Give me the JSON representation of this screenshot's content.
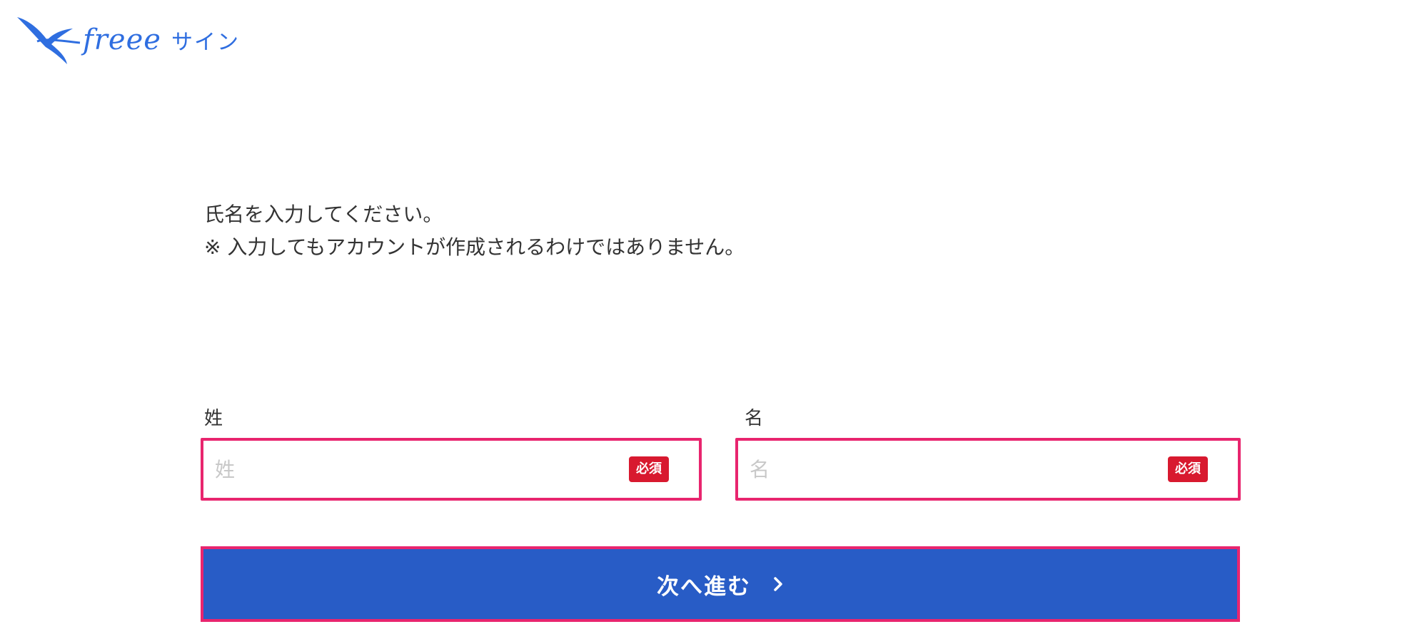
{
  "header": {
    "logo_word": "freee",
    "logo_product": "サイン"
  },
  "instructions": {
    "line1": "氏名を入力してください。",
    "line2": "※ 入力してもアカウントが作成されるわけではありません。"
  },
  "form": {
    "last_name": {
      "label": "姓",
      "placeholder": "姓",
      "value": "",
      "badge": "必須"
    },
    "first_name": {
      "label": "名",
      "placeholder": "名",
      "value": "",
      "badge": "必須"
    },
    "next_button_label": "次へ進む"
  },
  "icons": {
    "logo": "bird-icon",
    "next": "chevron-right-icon"
  },
  "colors": {
    "brand": "#2f6ee0",
    "button": "#285cc6",
    "highlight": "#e8256e",
    "required_badge": "#d8192f",
    "placeholder": "#c8c8c8",
    "text": "#333333"
  }
}
